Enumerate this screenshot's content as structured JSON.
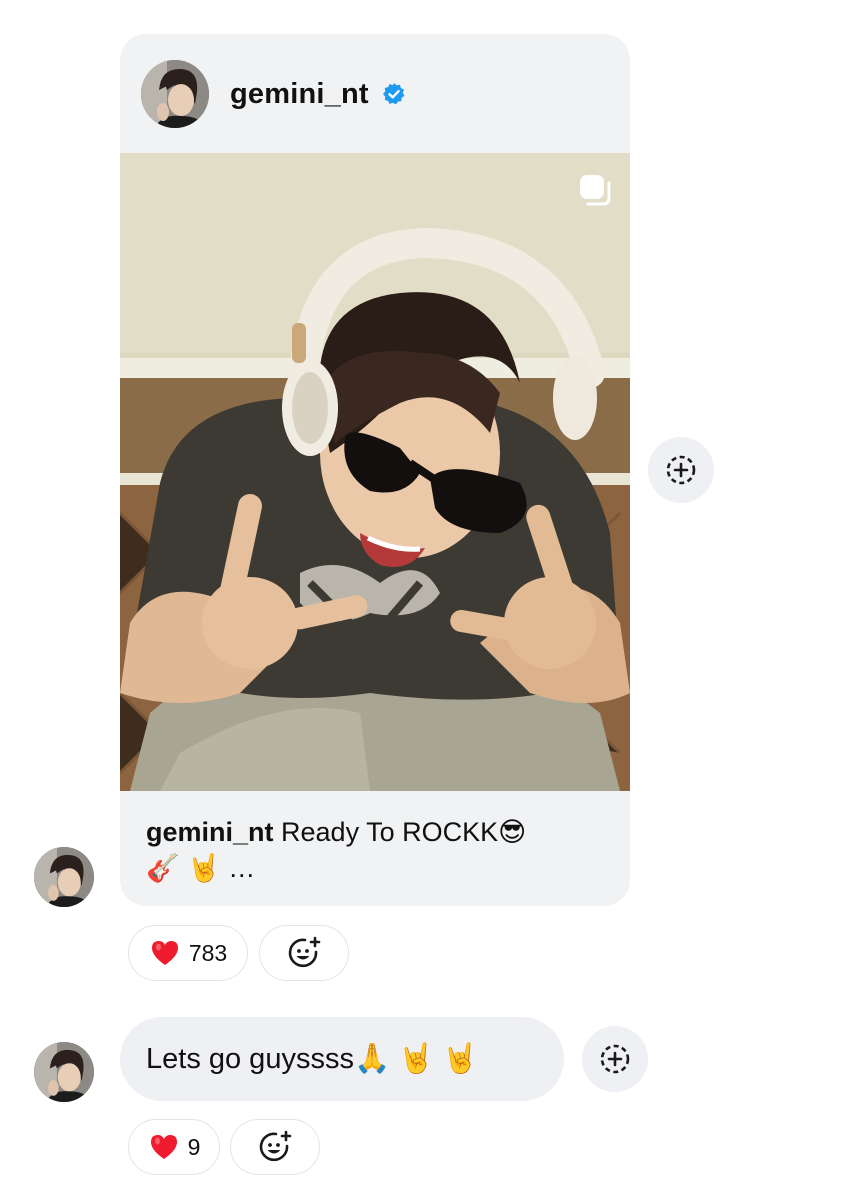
{
  "shared_post": {
    "username": "gemini_nt",
    "verified_icon": "verified-badge-icon",
    "carousel_icon": "multiple-photos-icon",
    "caption_user": "gemini_nt",
    "caption_text": " Ready To ROCKK😎",
    "caption_line2": "🎸 🤘 …",
    "accent_color": "#1d9bf0"
  },
  "post_reactions": {
    "heart": "❤️",
    "count": "783"
  },
  "message": {
    "text": "Lets go guyssss🙏 🤘 🤘"
  },
  "message_reactions": {
    "heart": "❤️",
    "count": "9"
  }
}
